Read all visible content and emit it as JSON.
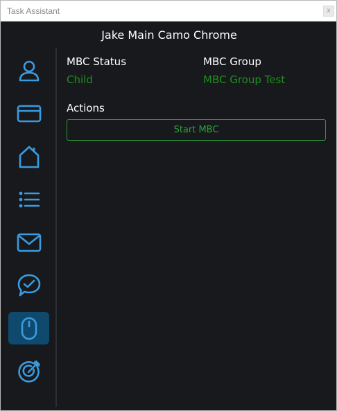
{
  "window": {
    "title": "Task Assistant",
    "close_label": "x"
  },
  "app": {
    "title": "Jake Main Camo Chrome"
  },
  "sidebar": {
    "items": [
      {
        "icon": "user-icon",
        "active": false
      },
      {
        "icon": "card-icon",
        "active": false
      },
      {
        "icon": "home-icon",
        "active": false
      },
      {
        "icon": "list-icon",
        "active": false
      },
      {
        "icon": "mail-icon",
        "active": false
      },
      {
        "icon": "chat-check-icon",
        "active": false
      },
      {
        "icon": "mouse-icon",
        "active": true
      },
      {
        "icon": "target-icon",
        "active": false
      }
    ]
  },
  "main": {
    "status_label": "MBC Status",
    "status_value": "Child",
    "group_label": "MBC Group",
    "group_value": "MBC Group Test",
    "actions_label": "Actions",
    "start_button": "Start MBC"
  },
  "colors": {
    "icon": "#3a9be0",
    "value_green": "#1f8f1f",
    "button_border": "#2a9a3a",
    "active_bg": "#0f4a6e",
    "background": "#18191d"
  }
}
